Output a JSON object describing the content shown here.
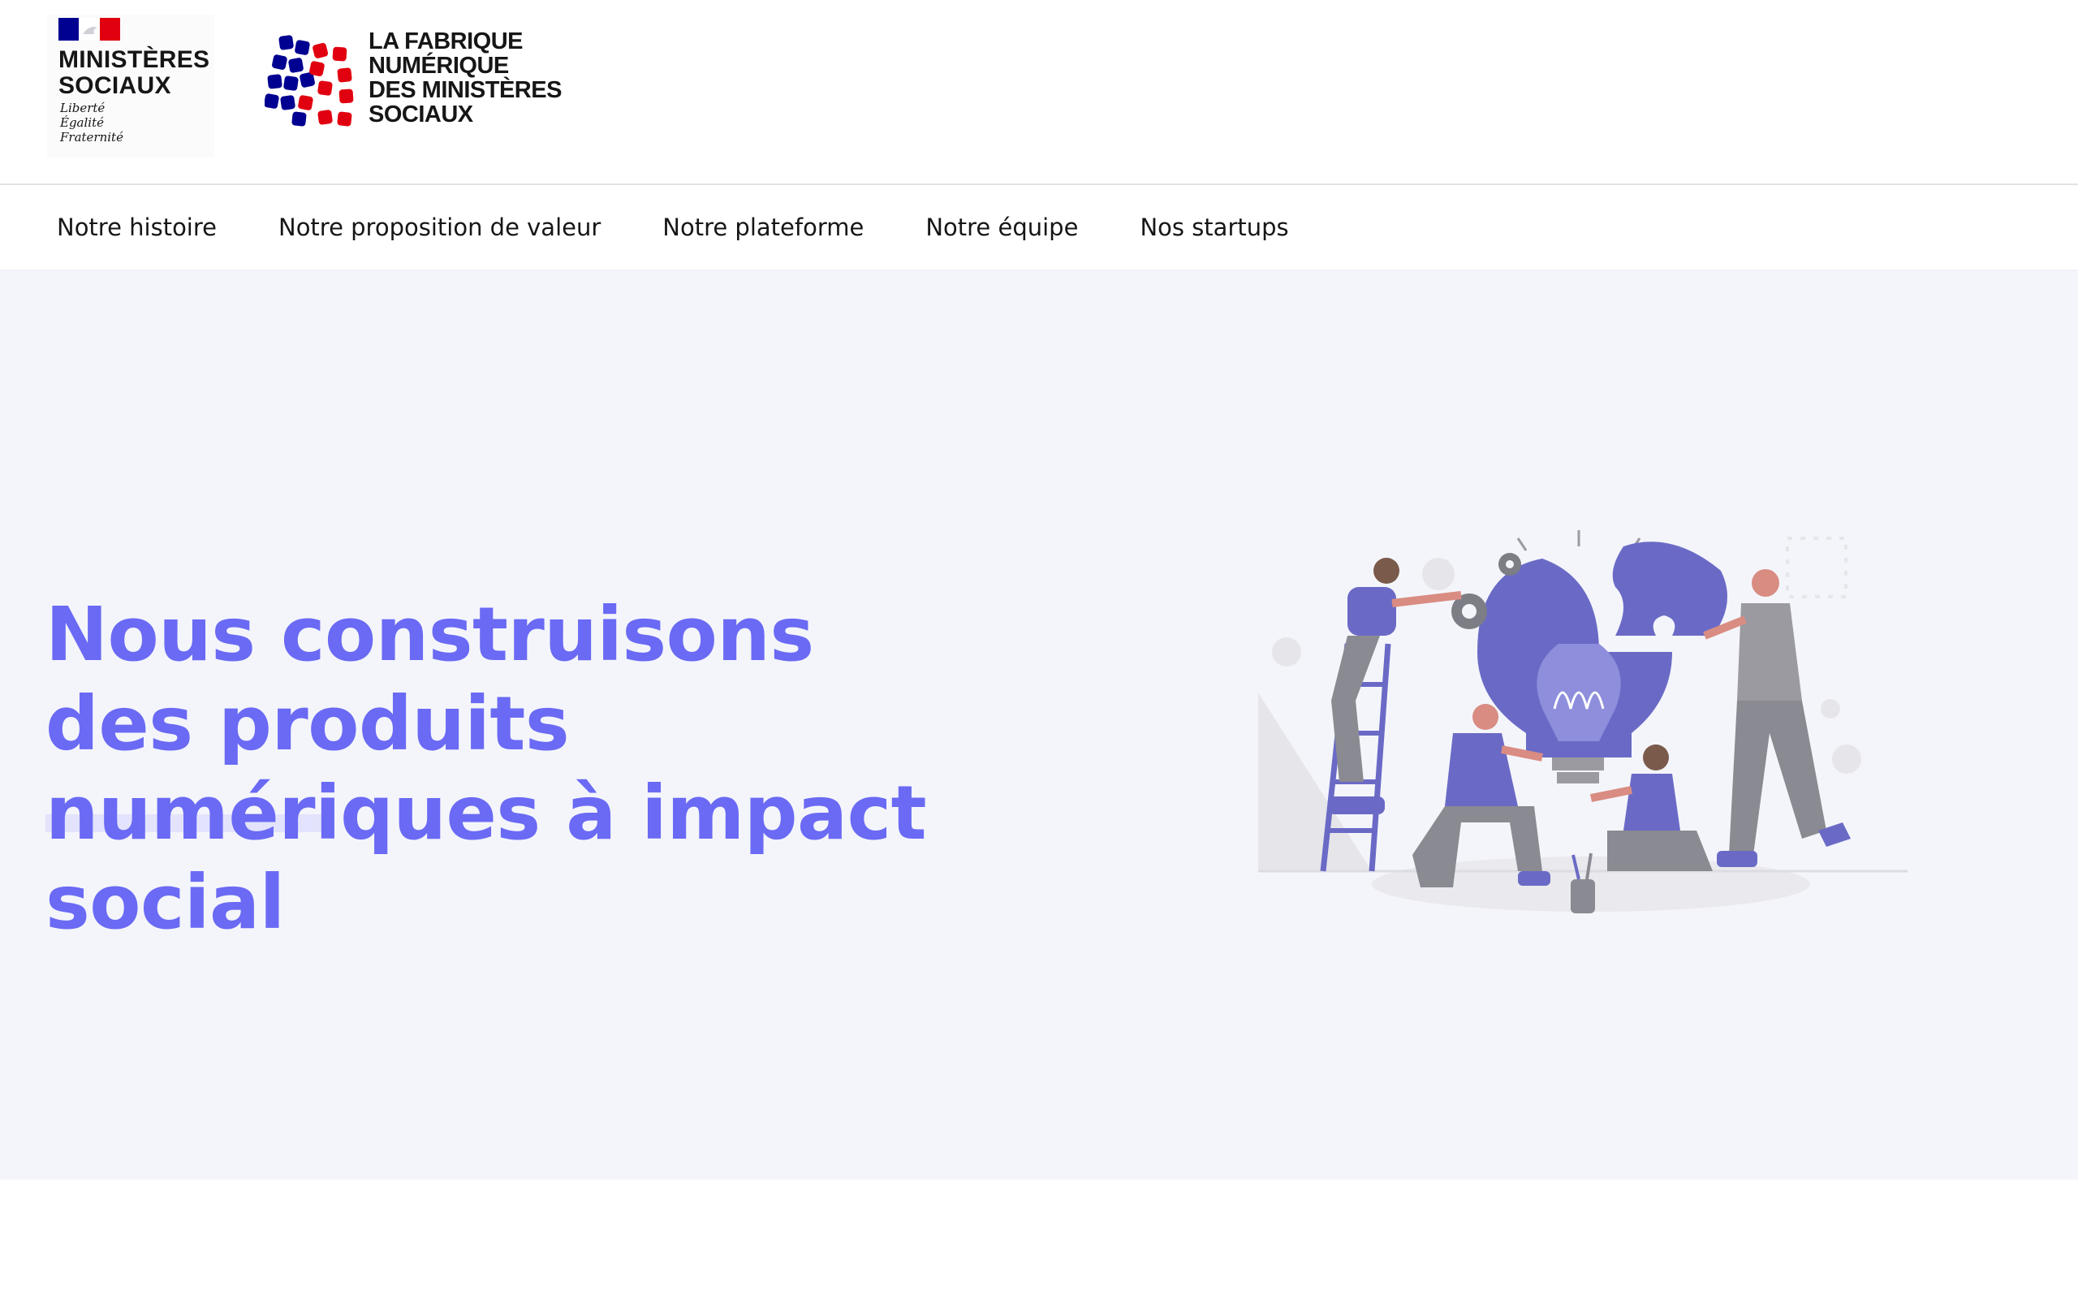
{
  "header": {
    "gov_logo": {
      "title": "MINISTÈRES\nSOCIAUX",
      "motto": "Liberté\nÉgalité\nFraternité",
      "flag_colors": [
        "#000091",
        "#ffffff",
        "#e1000f"
      ]
    },
    "fabrique_logo": {
      "title": "LA FABRIQUE\nNUMÉRIQUE\nDES MINISTÈRES\nSOCIAUX",
      "mosaic_colors": [
        "#000091",
        "#e1000f"
      ]
    }
  },
  "nav": {
    "items": [
      {
        "label": "Notre histoire"
      },
      {
        "label": "Notre proposition de valeur"
      },
      {
        "label": "Notre plateforme"
      },
      {
        "label": "Notre équipe"
      },
      {
        "label": "Nos startups"
      }
    ]
  },
  "hero": {
    "title": "Nous construisons des produits numériques à impact social",
    "illustration_icon": "team-building-lightbulb-illustration"
  },
  "colors": {
    "accent": "#6a6af4",
    "hero_bg": "#f4f5fb",
    "text": "#161616"
  }
}
